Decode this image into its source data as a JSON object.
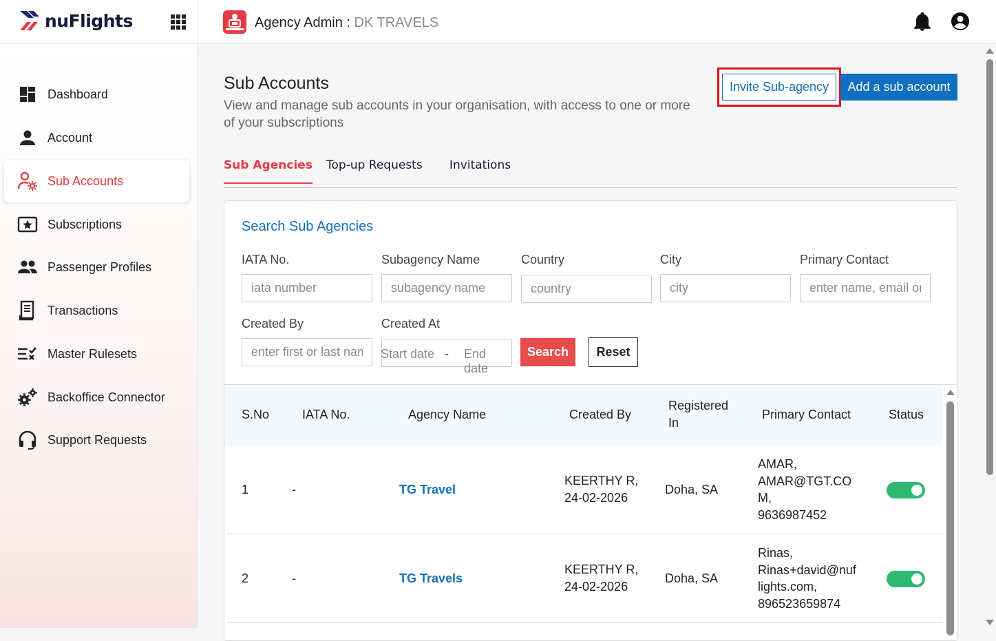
{
  "header": {
    "logo_text": "nuFlights",
    "title_prefix": "Agency Admin : ",
    "agency_name": "DK TRAVELS"
  },
  "sidebar": {
    "items": [
      {
        "label": "Dashboard",
        "icon": "dashboard-icon"
      },
      {
        "label": "Account",
        "icon": "person-icon"
      },
      {
        "label": "Sub Accounts",
        "icon": "sub-accounts-icon",
        "active": true
      },
      {
        "label": "Subscriptions",
        "icon": "subscriptions-icon"
      },
      {
        "label": "Passenger Profiles",
        "icon": "people-icon"
      },
      {
        "label": "Transactions",
        "icon": "receipt-icon"
      },
      {
        "label": "Master Rulesets",
        "icon": "rules-icon"
      },
      {
        "label": "Backoffice Connector",
        "icon": "gears-icon"
      },
      {
        "label": "Support Requests",
        "icon": "headset-icon"
      }
    ]
  },
  "main": {
    "title": "Sub Accounts",
    "description": "View and manage sub accounts in your organisation, with access to one or more of your subscriptions",
    "invite_button": "Invite Sub-agency",
    "add_button": "Add a sub account",
    "tabs": [
      "Sub Agencies",
      "Top-up Requests",
      "Invitations"
    ]
  },
  "search": {
    "title": "Search Sub Agencies",
    "labels": {
      "iata": "IATA No.",
      "subagency": "Subagency Name",
      "country": "Country",
      "city": "City",
      "primary_contact": "Primary Contact",
      "created_by": "Created By",
      "created_at": "Created At"
    },
    "placeholders": {
      "iata": "iata number",
      "subagency": "subagency name",
      "country": "country",
      "city": "city",
      "primary_contact": "enter name, email or",
      "created_by": "enter first or last nam",
      "start_date": "Start date",
      "end_date": "End date"
    },
    "date_separator": "-",
    "search_button": "Search",
    "reset_button": "Reset"
  },
  "table": {
    "headers": {
      "sno": "S.No",
      "iata": "IATA No.",
      "agency": "Agency Name",
      "created_by": "Created By",
      "registered_line1": "Registered",
      "registered_line2": "In",
      "contact": "Primary Contact",
      "status": "Status"
    },
    "rows": [
      {
        "sno": "1",
        "iata": "-",
        "agency": "TG Travel",
        "created_by_name": "KEERTHY R,",
        "created_by_date": "24-02-2026",
        "registered_in": "Doha, SA",
        "contact_lines": [
          "AMAR,",
          "AMAR@TGT.CO",
          "M,",
          "9636987452"
        ],
        "status_on": true
      },
      {
        "sno": "2",
        "iata": "-",
        "agency": "TG Travels",
        "created_by_name": "KEERTHY R,",
        "created_by_date": "24-02-2026",
        "registered_in": "Doha, SA",
        "contact_lines": [
          "Rinas,",
          "Rinas+david@nuf",
          "lights.com,",
          "896523659874"
        ],
        "status_on": true
      }
    ]
  }
}
